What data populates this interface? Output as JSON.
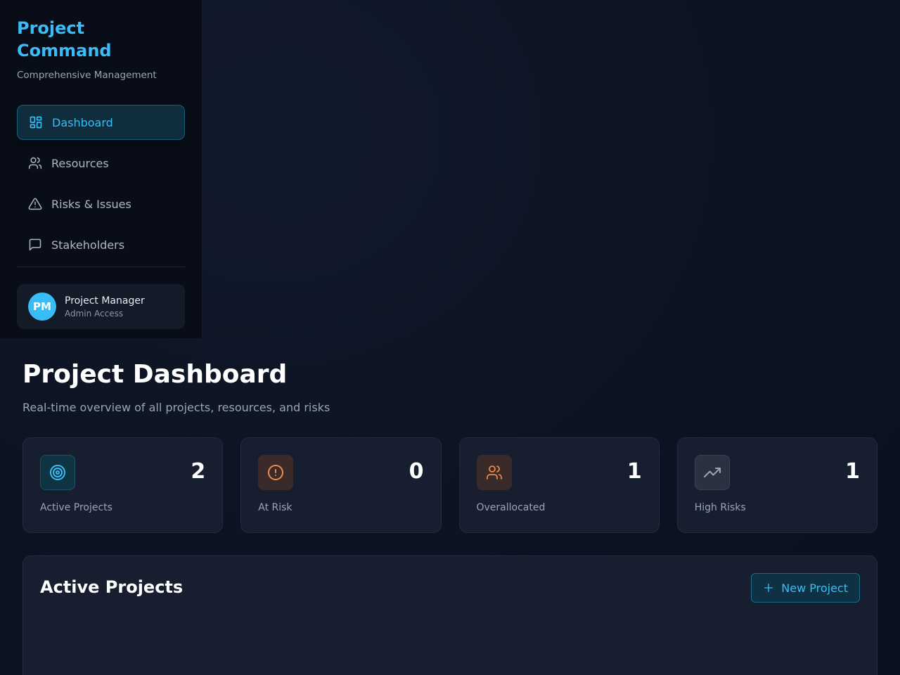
{
  "sidebar": {
    "brand_title": "Project Command",
    "brand_subtitle": "Comprehensive Management",
    "items": [
      {
        "label": "Dashboard",
        "icon": "dashboard-icon",
        "active": true
      },
      {
        "label": "Resources",
        "icon": "users-icon",
        "active": false
      },
      {
        "label": "Risks & Issues",
        "icon": "alert-triangle-icon",
        "active": false
      },
      {
        "label": "Stakeholders",
        "icon": "message-square-icon",
        "active": false
      }
    ],
    "user": {
      "initials": "PM",
      "name": "Project Manager",
      "role": "Admin Access"
    }
  },
  "main": {
    "title": "Project Dashboard",
    "subtitle": "Real-time overview of all projects, resources, and risks",
    "stats": [
      {
        "value": "2",
        "label": "Active Projects",
        "icon": "target-icon",
        "color": "#38bdf8",
        "bg": "#0f3342"
      },
      {
        "value": "0",
        "label": "At Risk",
        "icon": "alert-circle-icon",
        "color": "#f08a4b",
        "bg": "#3a2a2a"
      },
      {
        "value": "1",
        "label": "Overallocated",
        "icon": "users-icon",
        "color": "#f08a4b",
        "bg": "#3a2a2a"
      },
      {
        "value": "1",
        "label": "High Risks",
        "icon": "trending-up-icon",
        "color": "#9aa5b6",
        "bg": "#2a3140"
      }
    ],
    "panel": {
      "title": "Active Projects",
      "new_button_label": "New Project"
    }
  },
  "colors": {
    "accent": "#38bdf8",
    "warning": "#f08a4b"
  }
}
